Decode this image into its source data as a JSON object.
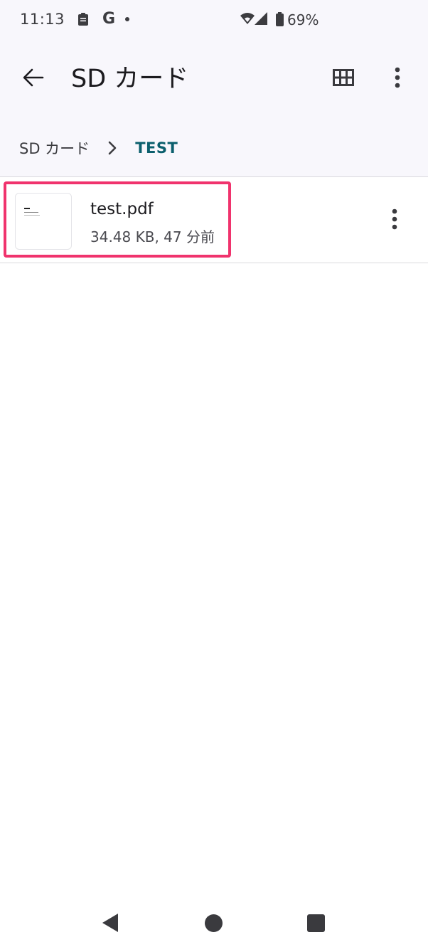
{
  "status_bar": {
    "time": "11:13",
    "battery_text": "69%",
    "google_glyph": "G",
    "icons": [
      "clipboard-icon",
      "google-icon",
      "dot-icon",
      "wifi-icon",
      "signal-icon",
      "battery-icon"
    ]
  },
  "app_bar": {
    "title": "SD カード",
    "back_icon": "arrow-back-icon",
    "grid_icon": "grid-view-icon",
    "menu_icon": "more-vert-icon"
  },
  "breadcrumb": {
    "root": "SD カード",
    "current": "TEST"
  },
  "files": [
    {
      "name": "test.pdf",
      "meta": "34.48 KB, 47 分前"
    }
  ],
  "colors": {
    "accent": "#0b5f6d",
    "highlight": "#f0336d",
    "surface": "#f8f7fc"
  }
}
